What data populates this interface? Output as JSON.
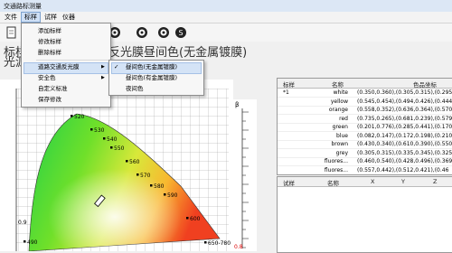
{
  "window": {
    "title": "交通路标测量"
  },
  "menubar": {
    "items": [
      "文件",
      "标样",
      "试样",
      "仪器"
    ],
    "active": "标样"
  },
  "toolbar": {
    "icons": [
      "new-document-icon",
      "target-icon",
      "target-icon",
      "color-wheel-icon",
      "settings-s-icon"
    ]
  },
  "header": {
    "label_sample": "标样",
    "label_source": "光源",
    "subtitle": "反光膜昼间色(无金属镀膜)"
  },
  "standard_menu": {
    "items": [
      "添加标样",
      "修改标样",
      "删除标样",
      "道路交通反光膜",
      "安全色",
      "自定义标准",
      "保存修改"
    ]
  },
  "submenu": {
    "items": [
      "昼间色(无金属镀膜)",
      "昼间色(有金属镀膜)",
      "夜间色"
    ],
    "checked": "昼间色(无金属镀膜)"
  },
  "chart_data": {
    "type": "scatter",
    "title": "",
    "xlabel": "",
    "ylabel": "",
    "wavelength_labels": [
      "520",
      "530",
      "540",
      "550",
      "560",
      "570",
      "580",
      "590",
      "600",
      "650-780",
      "490"
    ],
    "y_tick_label": "0.9",
    "beta_label": "β"
  },
  "beta_scale": {
    "label": "β",
    "bottom_label": "0.8"
  },
  "standard_table": {
    "headers": [
      "标样",
      "名称",
      "色品坐标"
    ],
    "rows": [
      [
        "*1",
        "white",
        "(0.350,0.360),(0.305,0.315),(0.295,"
      ],
      [
        "",
        "yellow",
        "(0.545,0.454),(0.494,0.426),(0.444,"
      ],
      [
        "",
        "orange",
        "(0.558,0.352),(0.636,0.364),(0.570,"
      ],
      [
        "",
        "red",
        "(0.735,0.265),(0.681,0.239),(0.579,"
      ],
      [
        "",
        "green",
        "(0.201,0.776),(0.285,0.441),(0.170,"
      ],
      [
        "",
        "blue",
        "(0.082,0.147),(0.172,0.198),(0.210,"
      ],
      [
        "",
        "brown",
        "(0.430,0.340),(0.610,0.390),(0.550,"
      ],
      [
        "",
        "grey",
        "(0.305,0.315),(0.335,0.345),(0.325,"
      ],
      [
        "",
        "fluores...",
        "(0.460,0.540),(0.428,0.496),(0.369,"
      ],
      [
        "",
        "fluores...",
        "(0.557,0.442),(0.512,0.421),(0.46"
      ]
    ]
  },
  "sample_table": {
    "headers": [
      "试样",
      "名称",
      "X",
      "Y",
      "Z"
    ]
  },
  "colors": {
    "accent": "#3a78c8",
    "titlebar": "#dce7f5",
    "menu_highlight": "#cfe0f6"
  }
}
